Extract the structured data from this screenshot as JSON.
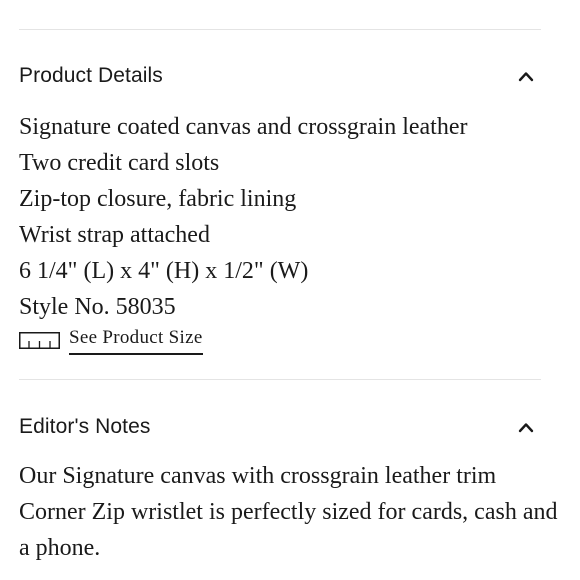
{
  "product_details": {
    "title": "Product Details",
    "items": [
      "Signature coated canvas and crossgrain leather",
      "Two credit card slots",
      "Zip-top closure, fabric lining",
      "Wrist strap attached",
      "6 1/4\" (L) x 4\" (H) x 1/2\" (W)",
      "Style No. 58035"
    ],
    "size_link_label": "See Product Size",
    "size_link_icon": "ruler-icon",
    "toggle_icon": "chevron-up-icon"
  },
  "editors_notes": {
    "title": "Editor's Notes",
    "text": "Our Signature canvas with crossgrain leather trim Corner Zip wristlet is perfectly sized for cards, cash and a phone.",
    "toggle_icon": "chevron-up-icon"
  }
}
